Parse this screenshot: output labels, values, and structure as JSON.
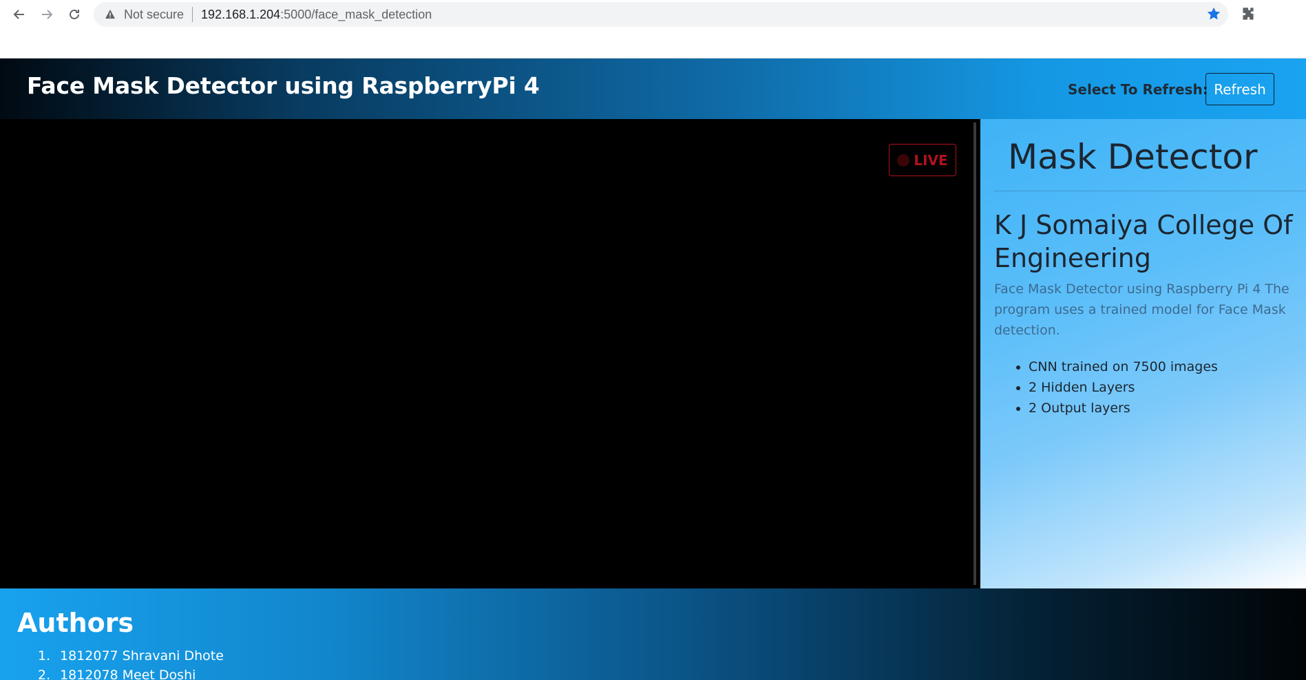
{
  "browser": {
    "security_label": "Not secure",
    "url_host": "192.168.1.204",
    "url_path": ":5000/face_mask_detection"
  },
  "header": {
    "title": "Face Mask Detector using RaspberryPi 4",
    "refresh_label": "Select To Refresh:",
    "refresh_button": "Refresh"
  },
  "video": {
    "live_label": "LIVE"
  },
  "side_panel": {
    "title": "Mask Detector",
    "college": "K J Somaiya College Of Engineering",
    "description": "Face Mask Detector using Raspberry Pi 4 The program uses a trained model for Face Mask detection.",
    "features": [
      "CNN trained on 7500 images",
      "2 Hidden Layers",
      "2 Output layers"
    ]
  },
  "authors": {
    "title": "Authors",
    "list": [
      {
        "num": "1.",
        "name": "1812077 Shravani Dhote"
      },
      {
        "num": "2.",
        "name": "1812078 Meet Doshi"
      }
    ]
  },
  "colors": {
    "star": "#1a73e8",
    "live": "#b0121d",
    "header_dark": "#010a12",
    "header_light": "#1aa3f1"
  }
}
